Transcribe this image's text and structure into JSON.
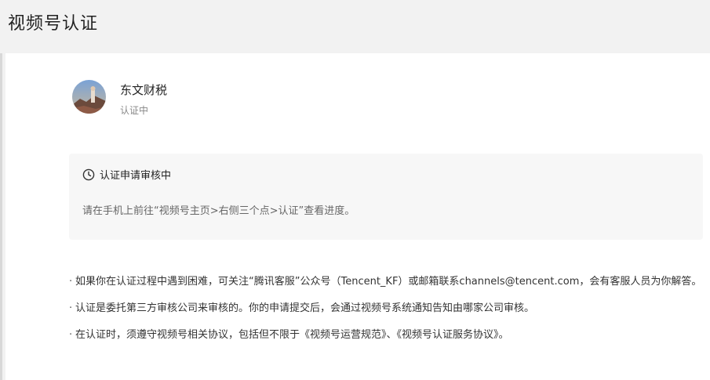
{
  "page": {
    "title": "视频号认证"
  },
  "account": {
    "name": "东文财税",
    "status": "认证中"
  },
  "notice": {
    "title": "认证申请审核中",
    "text": "请在手机上前往“视频号主页>右侧三个点>认证”查看进度。",
    "icon": "clock-icon"
  },
  "tips": [
    "如果你在认证过程中遇到困难，可关注“腾讯客服”公众号（Tencent_KF）或邮箱联系channels@tencent.com，会有客服人员为你解答。",
    "认证是委托第三方审核公司来审核的。你的申请提交后，会通过视频号系统通知告知由哪家公司审核。",
    "在认证时，须遵守视频号相关协议，包括但不限于《视频号运营规范》、《视频号认证服务协议》。"
  ],
  "colors": {
    "page_background": "#f2f2f2",
    "panel_background": "#ffffff",
    "notice_background": "#f7f7f7",
    "text_primary": "#222222",
    "text_secondary": "#888888"
  }
}
